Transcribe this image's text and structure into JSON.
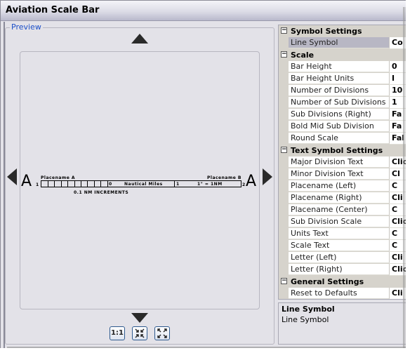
{
  "window": {
    "title": "Aviation Scale Bar"
  },
  "preview": {
    "legend": "Preview",
    "scalebar": {
      "letter_left": "A",
      "letter_right": "A",
      "placename_left": "Placename A",
      "placename_right": "Placename B",
      "left_number": "1",
      "right_number": "2",
      "zero_label": "0",
      "units_text": "Nautical Miles",
      "mid_label": "1",
      "scale_text": "1\" = 1NM",
      "sub_division_scale": "0.1 NM INCREMENTS",
      "sub_divisions": 10
    },
    "nav": {
      "up": "pan-up",
      "down": "pan-down",
      "left": "pan-left",
      "right": "pan-right"
    },
    "zoom_buttons": [
      {
        "label": "1:1",
        "icon": "actual-size-icon"
      },
      {
        "label": "⇲",
        "icon": "zoom-in-fit-icon"
      },
      {
        "label": "⤢",
        "icon": "zoom-out-full-icon"
      }
    ]
  },
  "property_grid": {
    "categories": [
      {
        "label": "Symbol Settings",
        "expanded": true,
        "properties": [
          {
            "name": "Line Symbol",
            "value": "Co",
            "selected": true
          }
        ]
      },
      {
        "label": "Scale",
        "expanded": true,
        "properties": [
          {
            "name": "Bar Height",
            "value": "0"
          },
          {
            "name": "Bar Height Units",
            "value": "I"
          },
          {
            "name": "Number of Divisions",
            "value": "10"
          },
          {
            "name": "Number of Sub Divisions",
            "value": "1"
          },
          {
            "name": "Sub Divisions (Right)",
            "value": "Fa"
          },
          {
            "name": "Bold Mid Sub Division",
            "value": "Fa"
          },
          {
            "name": "Round Scale",
            "value": "Fal"
          }
        ]
      },
      {
        "label": "Text Symbol Settings",
        "expanded": true,
        "properties": [
          {
            "name": "Major Division Text",
            "value": "Clic"
          },
          {
            "name": "Minor Division Text",
            "value": "Cl"
          },
          {
            "name": "Placename (Left)",
            "value": "C"
          },
          {
            "name": "Placename (Right)",
            "value": "Cli"
          },
          {
            "name": "Placename (Center)",
            "value": "C"
          },
          {
            "name": "Sub Division Scale",
            "value": "Clic"
          },
          {
            "name": "Units Text",
            "value": "C"
          },
          {
            "name": "Scale Text",
            "value": "C"
          },
          {
            "name": "Letter (Left)",
            "value": "Cli"
          },
          {
            "name": "Letter (Right)",
            "value": "Clic"
          }
        ]
      },
      {
        "label": "General Settings",
        "expanded": true,
        "properties": [
          {
            "name": "Reset to Defaults",
            "value": "Cli"
          }
        ]
      }
    ],
    "toggle_symbol": "−"
  },
  "description": {
    "title": "Line Symbol",
    "text": "Line Symbol"
  }
}
